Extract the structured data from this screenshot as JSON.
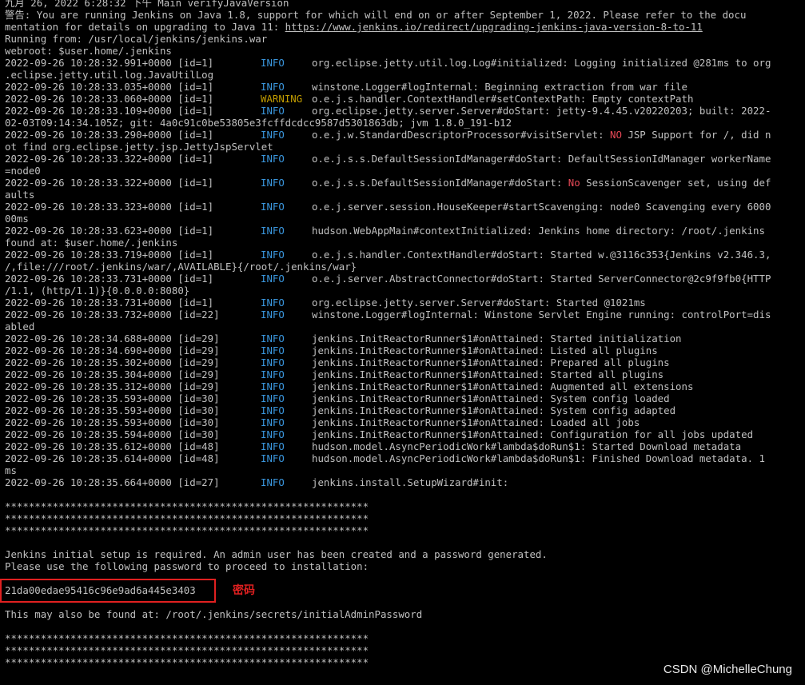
{
  "terminal": {
    "header": [
      "九月 26, 2022 6:28:32 下午 Main verifyJavaVersion",
      "警告: You are running Jenkins on Java 1.8, support for which will end on or after September 1, 2022. Please refer to the docu",
      "mentation for details on upgrading to Java 11: ",
      "https://www.jenkins.io/redirect/upgrading-jenkins-java-version-8-to-11",
      "Running from: /usr/local/jenkins/jenkins.war",
      "webroot: $user.home/.jenkins"
    ],
    "logs": [
      {
        "ts": "2022-09-26 10:28:32.991+0000 [id=1]",
        "level": "INFO",
        "msg": "org.eclipse.jetty.util.log.Log#initialized: Logging initialized @281ms to org",
        "cont": ".eclipse.jetty.util.log.JavaUtilLog"
      },
      {
        "ts": "2022-09-26 10:28:33.035+0000 [id=1]",
        "level": "INFO",
        "msg": "winstone.Logger#logInternal: Beginning extraction from war file"
      },
      {
        "ts": "2022-09-26 10:28:33.060+0000 [id=1]",
        "level": "WARNING",
        "msg": "o.e.j.s.handler.ContextHandler#setContextPath: Empty contextPath"
      },
      {
        "ts": "2022-09-26 10:28:33.109+0000 [id=1]",
        "level": "INFO",
        "msg": "org.eclipse.jetty.server.Server#doStart: jetty-9.4.45.v20220203; built: 2022-",
        "cont": "02-03T09:14:34.105Z; git: 4a0c91c0be53805e3fcffdcdcc9587d5301863db; jvm 1.8.0_191-b12"
      },
      {
        "ts": "2022-09-26 10:28:33.290+0000 [id=1]",
        "level": "INFO",
        "msg": "o.e.j.w.StandardDescriptorProcessor#visitServlet: ",
        "red": "NO",
        "rest": " JSP Support for /, did n",
        "cont": "ot find org.eclipse.jetty.jsp.JettyJspServlet"
      },
      {
        "ts": "2022-09-26 10:28:33.322+0000 [id=1]",
        "level": "INFO",
        "msg": "o.e.j.s.s.DefaultSessionIdManager#doStart: DefaultSessionIdManager workerName",
        "cont": "=node0"
      },
      {
        "ts": "2022-09-26 10:28:33.322+0000 [id=1]",
        "level": "INFO",
        "msg": "o.e.j.s.s.DefaultSessionIdManager#doStart: ",
        "red": "No",
        "rest": " SessionScavenger set, using def",
        "cont": "aults"
      },
      {
        "ts": "2022-09-26 10:28:33.323+0000 [id=1]",
        "level": "INFO",
        "msg": "o.e.j.server.session.HouseKeeper#startScavenging: node0 Scavenging every 6000",
        "cont": "00ms"
      },
      {
        "ts": "2022-09-26 10:28:33.623+0000 [id=1]",
        "level": "INFO",
        "msg": "hudson.WebAppMain#contextInitialized: Jenkins home directory: /root/.jenkins",
        "cont": "found at: $user.home/.jenkins"
      },
      {
        "ts": "2022-09-26 10:28:33.719+0000 [id=1]",
        "level": "INFO",
        "msg": "o.e.j.s.handler.ContextHandler#doStart: Started w.@3116c353{Jenkins v2.346.3,",
        "cont": "/,file:///root/.jenkins/war/,AVAILABLE}{/root/.jenkins/war}"
      },
      {
        "ts": "2022-09-26 10:28:33.731+0000 [id=1]",
        "level": "INFO",
        "msg": "o.e.j.server.AbstractConnector#doStart: Started ServerConnector@2c9f9fb0{HTTP",
        "cont": "/1.1, (http/1.1)}{0.0.0.0:8080}"
      },
      {
        "ts": "2022-09-26 10:28:33.731+0000 [id=1]",
        "level": "INFO",
        "msg": "org.eclipse.jetty.server.Server#doStart: Started @1021ms"
      },
      {
        "ts": "2022-09-26 10:28:33.732+0000 [id=22]",
        "level": "INFO",
        "msg": "winstone.Logger#logInternal: Winstone Servlet Engine running: controlPort=dis",
        "cont": "abled"
      },
      {
        "ts": "2022-09-26 10:28:34.688+0000 [id=29]",
        "level": "INFO",
        "msg": "jenkins.InitReactorRunner$1#onAttained: Started initialization"
      },
      {
        "ts": "2022-09-26 10:28:34.690+0000 [id=29]",
        "level": "INFO",
        "msg": "jenkins.InitReactorRunner$1#onAttained: Listed all plugins"
      },
      {
        "ts": "2022-09-26 10:28:35.302+0000 [id=29]",
        "level": "INFO",
        "msg": "jenkins.InitReactorRunner$1#onAttained: Prepared all plugins"
      },
      {
        "ts": "2022-09-26 10:28:35.304+0000 [id=29]",
        "level": "INFO",
        "msg": "jenkins.InitReactorRunner$1#onAttained: Started all plugins"
      },
      {
        "ts": "2022-09-26 10:28:35.312+0000 [id=29]",
        "level": "INFO",
        "msg": "jenkins.InitReactorRunner$1#onAttained: Augmented all extensions"
      },
      {
        "ts": "2022-09-26 10:28:35.593+0000 [id=30]",
        "level": "INFO",
        "msg": "jenkins.InitReactorRunner$1#onAttained: System config loaded"
      },
      {
        "ts": "2022-09-26 10:28:35.593+0000 [id=30]",
        "level": "INFO",
        "msg": "jenkins.InitReactorRunner$1#onAttained: System config adapted"
      },
      {
        "ts": "2022-09-26 10:28:35.593+0000 [id=30]",
        "level": "INFO",
        "msg": "jenkins.InitReactorRunner$1#onAttained: Loaded all jobs"
      },
      {
        "ts": "2022-09-26 10:28:35.594+0000 [id=30]",
        "level": "INFO",
        "msg": "jenkins.InitReactorRunner$1#onAttained: Configuration for all jobs updated"
      },
      {
        "ts": "2022-09-26 10:28:35.612+0000 [id=48]",
        "level": "INFO",
        "msg": "hudson.model.AsyncPeriodicWork#lambda$doRun$1: Started Download metadata"
      },
      {
        "ts": "2022-09-26 10:28:35.614+0000 [id=48]",
        "level": "INFO",
        "msg": "hudson.model.AsyncPeriodicWork#lambda$doRun$1: Finished Download metadata. 1",
        "cont": "ms"
      },
      {
        "ts": "2022-09-26 10:28:35.664+0000 [id=27]",
        "level": "INFO",
        "msg": "jenkins.install.SetupWizard#init:"
      }
    ],
    "separator": "*************************************************************",
    "setup_line1": "Jenkins initial setup is required. An admin user has been created and a password generated.",
    "setup_line2": "Please use the following password to proceed to installation:",
    "password": "21da00edae95416c96e9ad6a445e3403",
    "password_annotation": "密码",
    "found_line": "This may also be found at: /root/.jenkins/secrets/initialAdminPassword",
    "cursor": "--"
  },
  "watermark": "CSDN @MichelleChung",
  "colors": {
    "info": "#3a96dd",
    "warning": "#c19c00",
    "highlight": "#e74856",
    "annotation": "#e02020"
  }
}
